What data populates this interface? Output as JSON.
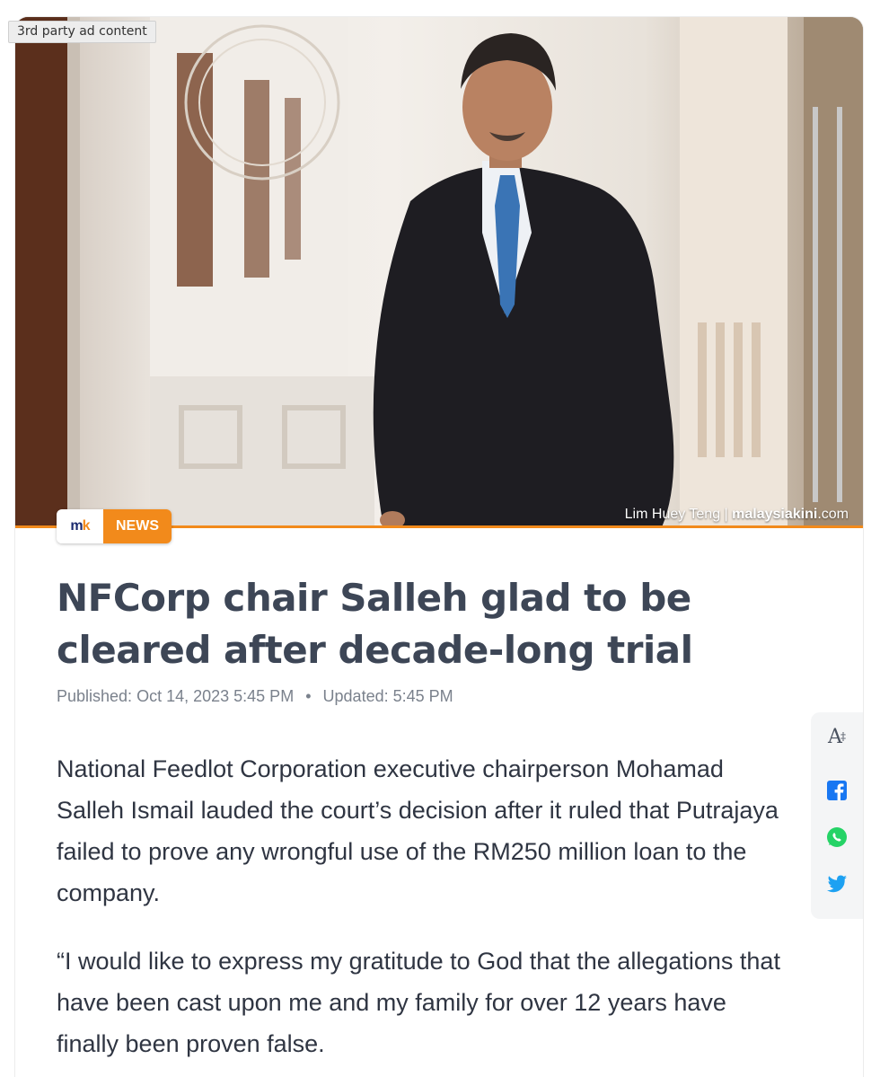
{
  "ad": {
    "label": "3rd party ad content"
  },
  "hero": {
    "photo_credit_name": "Lim Huey Teng",
    "photo_credit_site": "malaysiakini",
    "photo_credit_tld": ".com"
  },
  "badge": {
    "logo_main": "m",
    "logo_accent": "k",
    "tag": "NEWS"
  },
  "article": {
    "headline": "NFCorp chair Salleh glad to be cleared after decade-long trial",
    "published_label": "Published:",
    "published_value": "Oct 14, 2023 5:45 PM",
    "updated_label": "Updated:",
    "updated_value": "5:45 PM",
    "paragraphs": [
      "National Feedlot Corporation executive chairperson Mohamad Salleh Ismail lauded the court’s decision after it ruled that Putrajaya failed to prove any wrongful use of the RM250 million loan to the company.",
      "“I would like to express my gratitude to God that the allegations that have been cast upon me and my family for over 12 years have finally been proven false."
    ]
  },
  "share_rail": {
    "font_size_glyph": "A",
    "font_size_sup": "‡",
    "icons": [
      "font-size-icon",
      "facebook-icon",
      "whatsapp-icon",
      "twitter-icon"
    ]
  },
  "colors": {
    "accent": "#f28a1b",
    "headline": "#3d4656",
    "facebook": "#1877f2",
    "whatsapp": "#25d366",
    "twitter": "#1da1f2"
  }
}
